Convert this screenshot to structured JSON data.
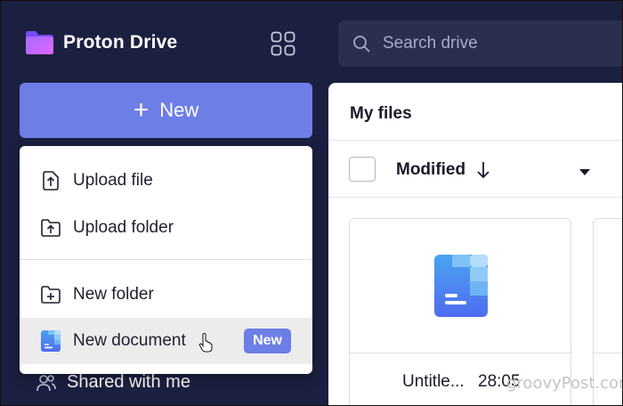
{
  "app": {
    "name": "Proton Drive"
  },
  "search": {
    "placeholder": "Search drive"
  },
  "new_button": {
    "label": "New"
  },
  "menu": {
    "items": [
      {
        "label": "Upload file",
        "icon": "upload-file-icon"
      },
      {
        "label": "Upload folder",
        "icon": "upload-folder-icon"
      },
      {
        "label": "New folder",
        "icon": "new-folder-icon"
      },
      {
        "label": "New document",
        "icon": "proton-docs-icon",
        "badge": "New"
      }
    ]
  },
  "sidebar": {
    "shared_label": "Shared with me"
  },
  "main": {
    "title": "My files",
    "sort_label": "Modified",
    "files": [
      {
        "name": "Untitle...",
        "time": "28:05",
        "icon": "proton-docs-icon"
      }
    ]
  },
  "watermark": "groovyPost.com",
  "colors": {
    "background": "#1c2040",
    "accent": "#6d7ee6",
    "search_bg": "#2a2f50",
    "menu_hover": "#ececec"
  }
}
